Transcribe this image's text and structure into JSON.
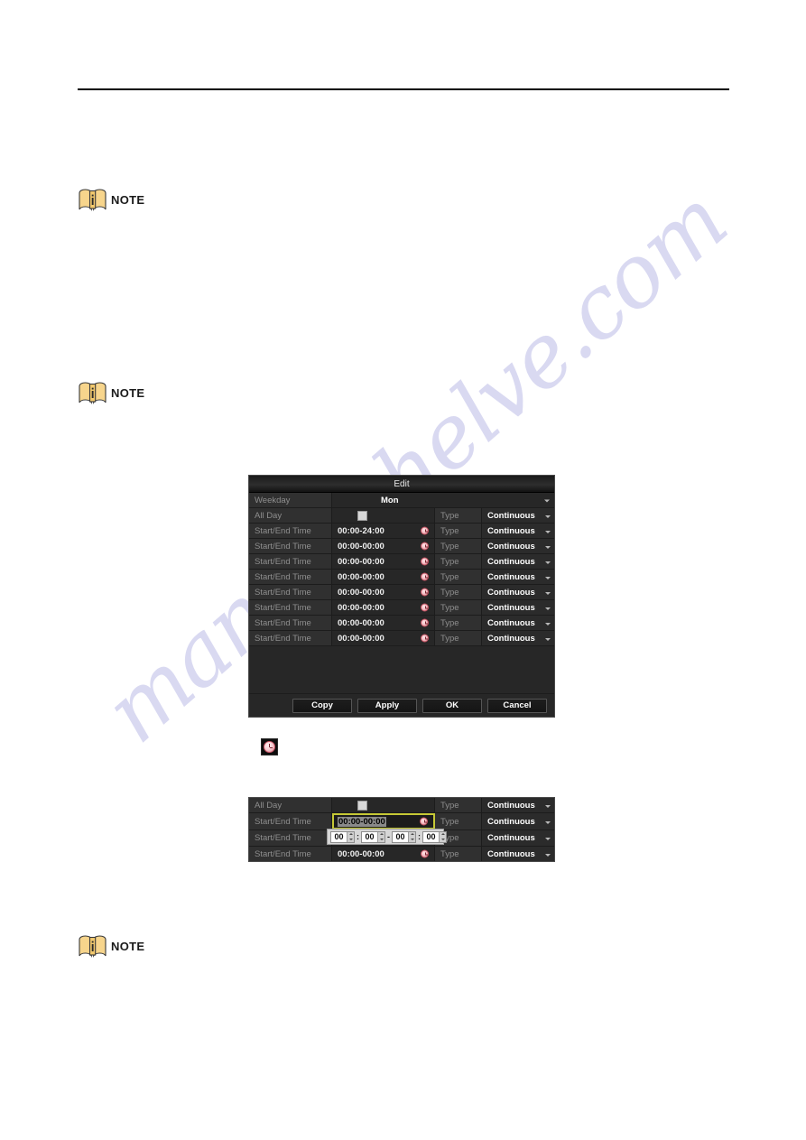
{
  "page": {
    "watermark": "manualshelve.com"
  },
  "notes": [
    {
      "label": "NOTE",
      "icon": "note-book-icon"
    },
    {
      "label": "NOTE",
      "icon": "note-book-icon"
    },
    {
      "label": "NOTE",
      "icon": "note-book-icon"
    }
  ],
  "clock_icon_figure": {
    "icon": "clock-icon"
  },
  "edit_dialog": {
    "title": "Edit",
    "weekday": {
      "label": "Weekday",
      "value": "Mon",
      "chevron": "chevron-down-icon"
    },
    "all_day": {
      "label": "All Day",
      "checked": false,
      "type_label": "Type",
      "type_value": "Continuous",
      "chevron": "chevron-down-icon"
    },
    "schedule_rows": [
      {
        "label": "Start/End Time",
        "time": "00:00-24:00",
        "clock": "clock-icon",
        "type_label": "Type",
        "type_value": "Continuous"
      },
      {
        "label": "Start/End Time",
        "time": "00:00-00:00",
        "clock": "clock-icon",
        "type_label": "Type",
        "type_value": "Continuous"
      },
      {
        "label": "Start/End Time",
        "time": "00:00-00:00",
        "clock": "clock-icon",
        "type_label": "Type",
        "type_value": "Continuous"
      },
      {
        "label": "Start/End Time",
        "time": "00:00-00:00",
        "clock": "clock-icon",
        "type_label": "Type",
        "type_value": "Continuous"
      },
      {
        "label": "Start/End Time",
        "time": "00:00-00:00",
        "clock": "clock-icon",
        "type_label": "Type",
        "type_value": "Continuous"
      },
      {
        "label": "Start/End Time",
        "time": "00:00-00:00",
        "clock": "clock-icon",
        "type_label": "Type",
        "type_value": "Continuous"
      },
      {
        "label": "Start/End Time",
        "time": "00:00-00:00",
        "clock": "clock-icon",
        "type_label": "Type",
        "type_value": "Continuous"
      },
      {
        "label": "Start/End Time",
        "time": "00:00-00:00",
        "clock": "clock-icon",
        "type_label": "Type",
        "type_value": "Continuous"
      }
    ],
    "buttons": [
      {
        "label": "Copy"
      },
      {
        "label": "Apply"
      },
      {
        "label": "OK"
      },
      {
        "label": "Cancel"
      }
    ]
  },
  "detail_panel": {
    "all_day": {
      "label": "All Day",
      "checked": false,
      "type_label": "Type",
      "type_value": "Continuous"
    },
    "focused_row": {
      "label": "Start/End Time",
      "time": "00:00-00:00",
      "clock": "clock-icon",
      "type_label": "Type",
      "type_value": "Continuous"
    },
    "picker_row": {
      "label": "Start/End Time",
      "type_label": "Type",
      "type_value": "Continuous",
      "time_picker": {
        "start_hour": "00",
        "start_minute": "00",
        "end_hour": "00",
        "end_minute": "00",
        "separator_colon": ":",
        "separator_dash": "-"
      }
    },
    "last_row": {
      "label": "Start/End Time",
      "time": "00:00-00:00",
      "clock": "clock-icon",
      "type_label": "Type",
      "type_value": "Continuous"
    }
  },
  "colors": {
    "dialog_bg": "#272727",
    "label_bg": "#303030",
    "focus_border": "#c6c936",
    "note_icon": "#f5cf7c",
    "watermark": "#6c6cc8"
  }
}
